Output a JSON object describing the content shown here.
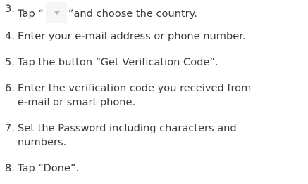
{
  "steps": [
    {
      "num": "3.",
      "pre": "Tap “",
      "icon": "chevron-down-icon",
      "post": "”and choose the country."
    },
    {
      "num": "4.",
      "text": "Enter your e-mail address or phone number."
    },
    {
      "num": "5.",
      "text": "Tap the button “Get Verification Code”."
    },
    {
      "num": "6.",
      "line1": "Enter the verification code you received from",
      "line2": "e-mail or smart phone."
    },
    {
      "num": "7.",
      "line1": "Set the Password including characters and",
      "line2": "numbers."
    },
    {
      "num": "8.",
      "text": "Tap “Done”."
    }
  ]
}
